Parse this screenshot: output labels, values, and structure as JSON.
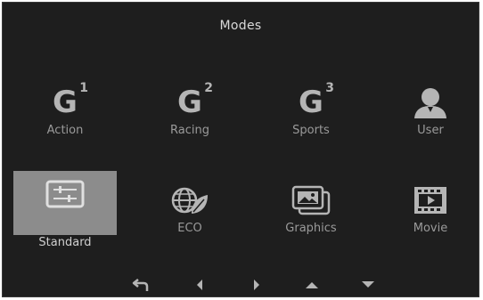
{
  "title": "Modes",
  "modes": [
    {
      "label": "Action",
      "icon": "g1-icon",
      "glyph": "G",
      "sup": "1"
    },
    {
      "label": "Racing",
      "icon": "g2-icon",
      "glyph": "G",
      "sup": "2"
    },
    {
      "label": "Sports",
      "icon": "g3-icon",
      "glyph": "G",
      "sup": "3"
    },
    {
      "label": "User",
      "icon": "user-icon"
    },
    {
      "label": "Standard",
      "icon": "sliders-icon",
      "selected": true
    },
    {
      "label": "ECO",
      "icon": "eco-globe-icon"
    },
    {
      "label": "Graphics",
      "icon": "picture-stack-icon"
    },
    {
      "label": "Movie",
      "icon": "film-icon"
    }
  ],
  "nav": [
    "back-icon",
    "left-arrow-icon",
    "right-arrow-icon",
    "up-arrow-icon",
    "down-arrow-icon"
  ],
  "colors": {
    "background": "#1e1e1e",
    "selected": "#8c8c8c",
    "icon": "#b5b5b5",
    "text": "#9a9a9a"
  }
}
